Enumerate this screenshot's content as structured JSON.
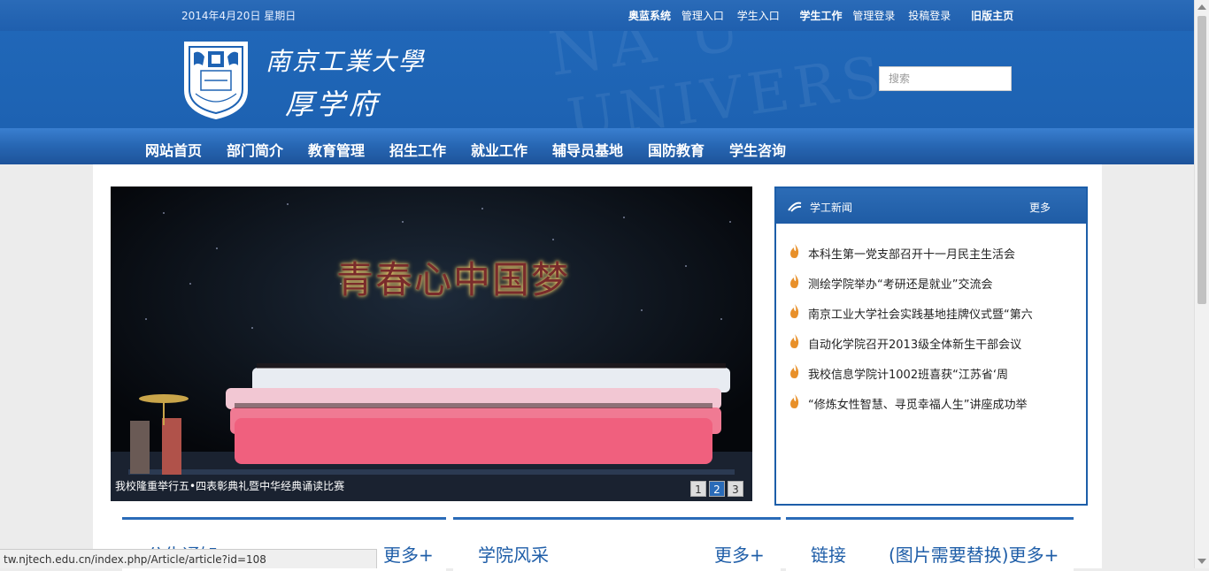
{
  "topbar": {
    "date": "2014年4月20日 星期日",
    "links": [
      {
        "label": "奥蓝系统",
        "bold": true
      },
      {
        "label": "管理入口",
        "bold": false
      },
      {
        "label": "学生入口",
        "bold": false
      },
      {
        "label": "学生工作",
        "bold": true
      },
      {
        "label": "管理登录",
        "bold": false
      },
      {
        "label": "投稿登录",
        "bold": false
      },
      {
        "label": "旧版主页",
        "bold": true
      }
    ]
  },
  "header": {
    "university_name": "南京工業大學",
    "site_name": "厚学府",
    "search_placeholder": "搜索"
  },
  "nav": {
    "items": [
      "网站首页",
      "部门简介",
      "教育管理",
      "招生工作",
      "就业工作",
      "辅导员基地",
      "国防教育",
      "学生咨询"
    ]
  },
  "slideshow": {
    "banner_text": "青春心中国梦",
    "caption": "我校隆重举行五•四表彰典礼暨中华经典诵读比赛",
    "pages": [
      "1",
      "2",
      "3"
    ],
    "active_page": "2"
  },
  "news": {
    "title": "学工新闻",
    "more": "更多",
    "items": [
      "本科生第一党支部召开十一月民主生活会",
      "测绘学院举办“考研还是就业”交流会",
      "南京工业大学社会实践基地挂牌仪式暨“第六",
      "自动化学院召开2013级全体新生干部会议",
      "我校信息学院计1002班喜获“江苏省‘周",
      "“修炼女性智慧、寻觅幸福人生”讲座成功举"
    ]
  },
  "sections": {
    "notice": {
      "title": "公告通知",
      "more": "更多+"
    },
    "college": {
      "title": "学院风采",
      "more": "更多+"
    },
    "links": {
      "title": "链接",
      "more": "(图片需要替换)更多+"
    }
  },
  "status_bar": {
    "url": "tw.njtech.edu.cn/index.php/Article/article?id=108"
  },
  "colors": {
    "primary": "#1e63b4",
    "nav": "#2868b5",
    "accent_flame": "#e8902a"
  }
}
